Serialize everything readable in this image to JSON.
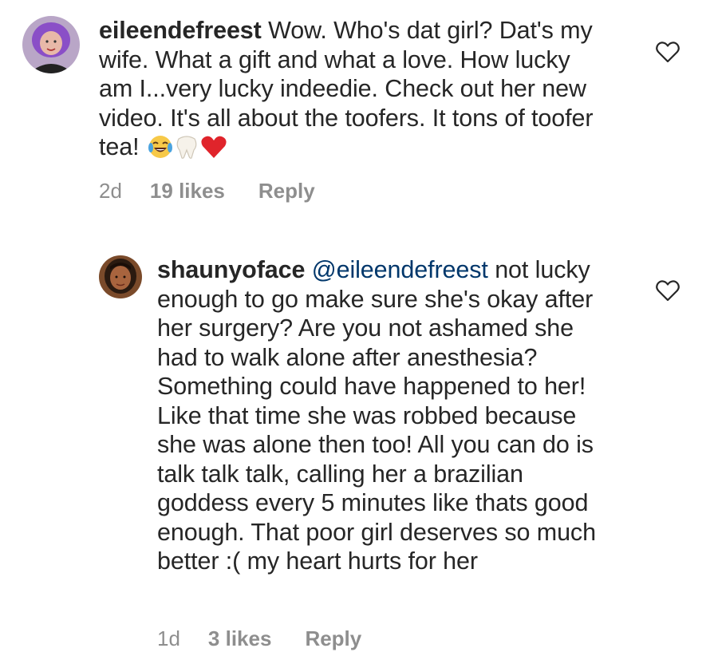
{
  "comments": [
    {
      "username": "eileendefreest",
      "mention": "",
      "text": "Wow. Who's dat girl? Dat's my wife. What a gift and what a love. How lucky am I...very lucky indeedie. Check out her new video. It's all about the toofers. It tons of toofer tea!",
      "emojis": [
        "tears-of-joy-emoji",
        "tooth-emoji",
        "red-heart-emoji"
      ],
      "time": "2d",
      "likes": "19 likes",
      "reply": "Reply"
    },
    {
      "username": "shaunyoface",
      "mention": "@eileendefreest",
      "text": "not lucky enough to go make sure she's okay after her surgery? Are you not ashamed she had to walk alone after anesthesia? Something could have happened to her! Like that time she was robbed because she was alone then too! All you can do is talk talk talk, calling her a brazilian goddess every 5 minutes like thats good enough. That poor girl deserves so much better :( my heart hurts for her",
      "time": "1d",
      "likes": "3 likes",
      "reply": "Reply"
    }
  ]
}
